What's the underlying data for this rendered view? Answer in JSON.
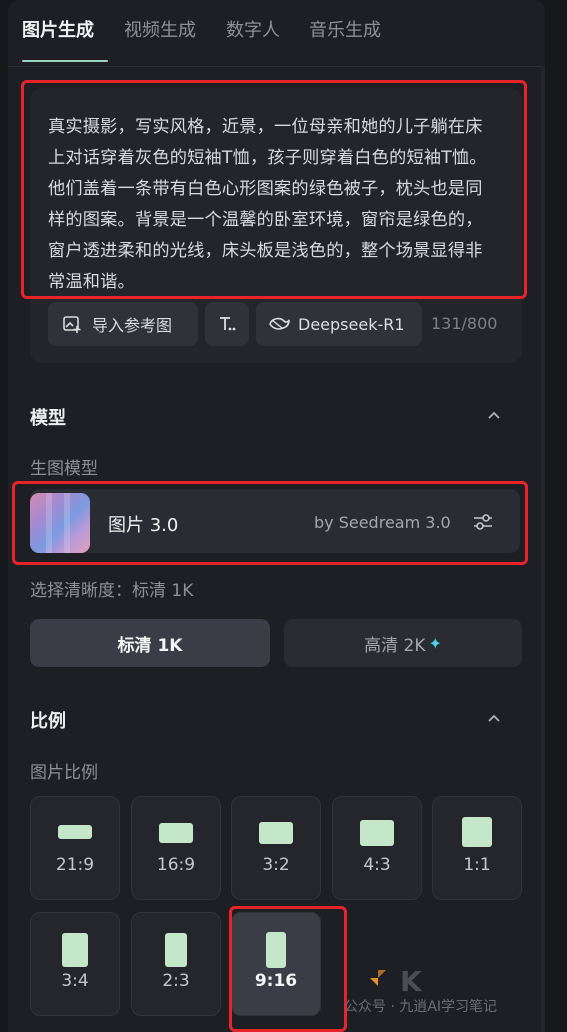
{
  "tabs": [
    {
      "label": "图片生成",
      "active": true
    },
    {
      "label": "视频生成",
      "active": false
    },
    {
      "label": "数字人",
      "active": false
    },
    {
      "label": "音乐生成",
      "active": false
    }
  ],
  "prompt": {
    "text": "真实摄影，写实风格，近景，一位母亲和她的儿子躺在床上对话穿着灰色的短袖T恤，孩子则穿着白色的短袖T恤。他们盖着一条带有白色心形图案的绿色被子，枕头也是同样的图案。背景是一个温馨的卧室环境，窗帘是绿色的，窗户透进柔和的光线，床头板是浅色的，整个场景显得非常温和谐。",
    "import_ref_label": "导入参考图",
    "model_chip_label": "Deepseek-R1",
    "counter": "131/800"
  },
  "model_section": {
    "title": "模型",
    "sub_label": "生图模型",
    "model_name": "图片 3.0",
    "model_by": "by Seedream 3.0"
  },
  "resolution": {
    "label": "选择清晰度：标清 1K",
    "options": [
      {
        "label": "标清 1K",
        "selected": true
      },
      {
        "label": "高清 2K",
        "selected": false,
        "icon": "sparkle-icon"
      }
    ]
  },
  "ratio_section": {
    "title": "比例",
    "sub_label": "图片比例",
    "options": [
      {
        "label": "21:9",
        "selected": false
      },
      {
        "label": "16:9",
        "selected": false
      },
      {
        "label": "3:2",
        "selected": false
      },
      {
        "label": "4:3",
        "selected": false
      },
      {
        "label": "1:1",
        "selected": false
      },
      {
        "label": "3:4",
        "selected": false
      },
      {
        "label": "2:3",
        "selected": false
      },
      {
        "label": "9:16",
        "selected": true
      }
    ]
  },
  "watermark": {
    "text": "公众号 · 九逍AI学习笔记"
  },
  "colors": {
    "accent": "#9ed3c0",
    "highlight_box": "#e8242a",
    "ratio_shape": "#c4e6c9",
    "sparkle": "#4fd0e6"
  }
}
